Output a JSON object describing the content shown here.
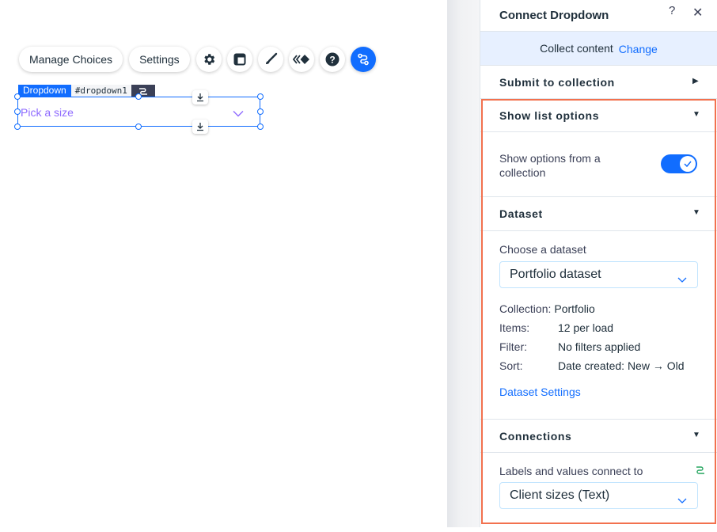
{
  "toolbar": {
    "manage_choices": "Manage Choices",
    "settings": "Settings",
    "icons": [
      "gear-icon",
      "layout-icon",
      "brush-icon",
      "animation-icon",
      "help-icon",
      "connect-icon"
    ]
  },
  "element": {
    "type_label": "Dropdown",
    "id_label": "#dropdown1",
    "placeholder": "Pick a size"
  },
  "panel": {
    "title": "Connect Dropdown",
    "help": "?",
    "close": "✕",
    "collect_label": "Collect content",
    "collect_change": "Change",
    "submit_section": "Submit to collection",
    "show_list_section": "Show list options",
    "show_options_label": "Show options from a collection",
    "show_options_enabled": true,
    "dataset_section": "Dataset",
    "choose_dataset_label": "Choose a dataset",
    "dataset_value": "Portfolio dataset",
    "collection_key": "Collection:",
    "collection_value": "Portfolio",
    "items_key": "Items:",
    "items_value": "12 per load",
    "filter_key": "Filter:",
    "filter_value": "No filters applied",
    "sort_key": "Sort:",
    "sort_value": "Date created: New → Old",
    "dataset_settings_link": "Dataset Settings",
    "connections_section": "Connections",
    "labels_connect_label": "Labels and values connect to",
    "labels_connect_value": "Client sizes (Text)"
  },
  "colors": {
    "accent": "#116dff",
    "highlight": "#f2714e",
    "placeholder": "#8f6bff",
    "collect_bg": "#e7f0ff",
    "connected_icon": "#25a55f"
  }
}
